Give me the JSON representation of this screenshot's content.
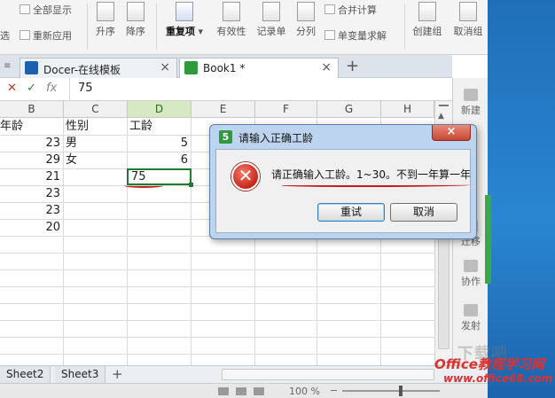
{
  "ribbon": {
    "show_all": "全部显示",
    "reapply": "重新应用",
    "filter_cut": "选",
    "sort_asc": "升序",
    "sort_desc": "降序",
    "duplicates": "重复项",
    "validity": "有效性",
    "records": "记录单",
    "split": "分列",
    "merge_calc": "合并计算",
    "what_if": "单变量求解",
    "create_group": "创建组",
    "ungroup": "取消组"
  },
  "tabs": [
    {
      "label": "Docer-在线模板",
      "close": "×"
    },
    {
      "label": "Book1 *",
      "close": "×"
    }
  ],
  "new_tab": "+",
  "formula": {
    "cancel": "✕",
    "confirm": "✓",
    "fx": "fx",
    "value": "75"
  },
  "columns": [
    "B",
    "C",
    "D",
    "E",
    "F",
    "G",
    "H"
  ],
  "cells": {
    "b1": "年龄",
    "c1": "性别",
    "d1": "工龄",
    "b2": "23",
    "c2": "男",
    "d2": "5",
    "b3": "29",
    "c3": "女",
    "d3": "6",
    "b4": "21",
    "d4": "75",
    "b5": "23",
    "b6": "23",
    "b7": "20"
  },
  "right_panel": {
    "new": "新建",
    "migrate": "迁移",
    "collab": "协作",
    "publish": "发射"
  },
  "sheets": [
    "Sheet2",
    "Sheet3"
  ],
  "add_sheet": "+",
  "status": {
    "zoom": "100 %"
  },
  "dialog": {
    "app_icon": "5",
    "title": "请输入正确工龄",
    "close": "×",
    "message": "请正确输入工龄。1~30。不到一年算一年",
    "retry": "重试",
    "cancel": "取消"
  },
  "watermark": {
    "line1": "Office教程学习网",
    "line2": "www.office68.com"
  },
  "colors": {
    "accent_green": "#217a31",
    "error_red": "#c8261a",
    "desktop_blue": "#2a86d0"
  }
}
